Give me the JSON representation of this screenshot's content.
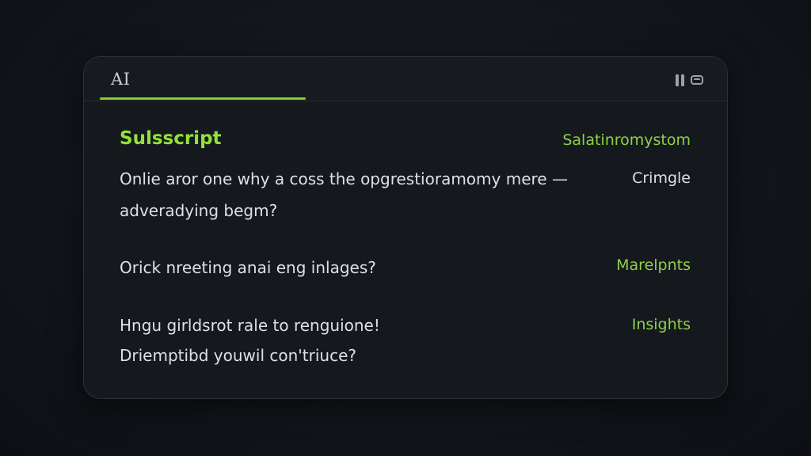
{
  "header": {
    "tab_label": "AI",
    "accent_color": "#7fd12a"
  },
  "title": {
    "text": "Sulsscript",
    "side_text": "Salatinromystom"
  },
  "rows": [
    {
      "lines": [
        "Onlie aror one why a coss the opgrestioramomy mere —",
        "adveradying begm?"
      ],
      "side": "Crimgle"
    },
    {
      "lines": [
        "Orick nreeting anai eng inlages?"
      ],
      "side": "Marelpnts"
    },
    {
      "lines": [
        "Hngu girldsrot rale to renguione!",
        "Driemptibd youwil con'triuce?"
      ],
      "side": "Insights"
    }
  ],
  "icons": {
    "pause": "pause-icon",
    "window": "window-icon"
  }
}
